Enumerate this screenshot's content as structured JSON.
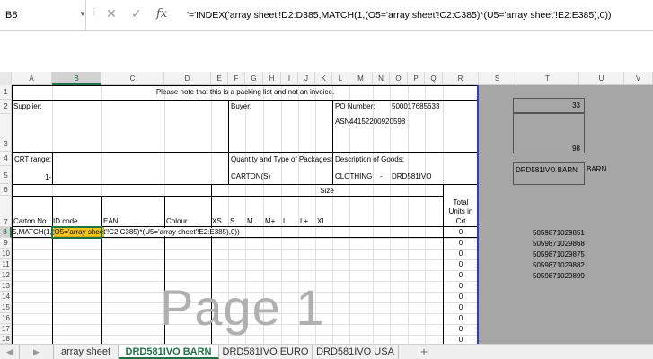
{
  "namebox": {
    "value": "B8"
  },
  "formula_bar": {
    "formula": "'='INDEX('array sheet'!D2:D385,MATCH(1,(O5='array sheet'!C2:C385)*(U5='array sheet'!E2:E385),0))",
    "cancel": "✕",
    "enter": "✓",
    "fx": "fx"
  },
  "columns": [
    "A",
    "B",
    "C",
    "D",
    "E",
    "F",
    "G",
    "H",
    "I",
    "J",
    "K",
    "L",
    "M",
    "N",
    "O",
    "P",
    "Q",
    "R",
    "S",
    "T",
    "U",
    "V"
  ],
  "rows": [
    "1",
    "2",
    "3",
    "4",
    "5",
    "6",
    "7",
    "8",
    "9",
    "10",
    "11",
    "12",
    "13",
    "14",
    "15",
    "16",
    "17",
    "18"
  ],
  "sheet": {
    "notice": "Please note that this is a packing list and not an invoice.",
    "supplier_label": "Supplier:",
    "buyer_label": "Buyer:",
    "po_label": "PO Number:",
    "po_value": "500017685633",
    "asn_label": "ASN:",
    "asn_value": "44152200920598",
    "crt_label": "CRT range:",
    "crt_value": "1-",
    "qty_label": "Quantity and Type of Packages:",
    "qty_value": "CARTON(S)",
    "desc_label": "Description of Goods:",
    "desc_value1": "CLOTHING",
    "desc_dash": "-",
    "desc_value2": "DRD581IVO",
    "size_label": "Size",
    "h_carton": "Carton No",
    "h_id": "ID code",
    "h_ean": "EAN",
    "h_colour": "Colour",
    "h_xs": "XS",
    "h_s": "S",
    "h_m": "M",
    "h_mplus": "M+",
    "h_l": "L",
    "h_lplus": "L+",
    "h_xl": "XL",
    "h_total1": "Total",
    "h_total2": "Units in",
    "h_total3": "Crt",
    "edit_prefix": "5,MATCH(1,(",
    "edit_highlight": "O5='array shee",
    "edit_suffix": "t'!C2:C385)*(U5='array sheet'!E2:E385),0))",
    "totals": [
      "0",
      "0",
      "0",
      "0",
      "0",
      "0",
      "0",
      "0",
      "0",
      "0",
      "0"
    ],
    "watermark": "Page 1"
  },
  "side": {
    "box1": "33",
    "box2": "98",
    "name_box": "DRD581IVO BARN",
    "name_side": "BARN",
    "eans": [
      "5059871029851",
      "5059871029868",
      "5059871029875",
      "5059871029882",
      "5059871029899"
    ]
  },
  "tabs": [
    "array sheet",
    "DRD581IVO BARN",
    "DRD581IVO EURO",
    "DRD581IVO USA"
  ],
  "add_tab": "+"
}
